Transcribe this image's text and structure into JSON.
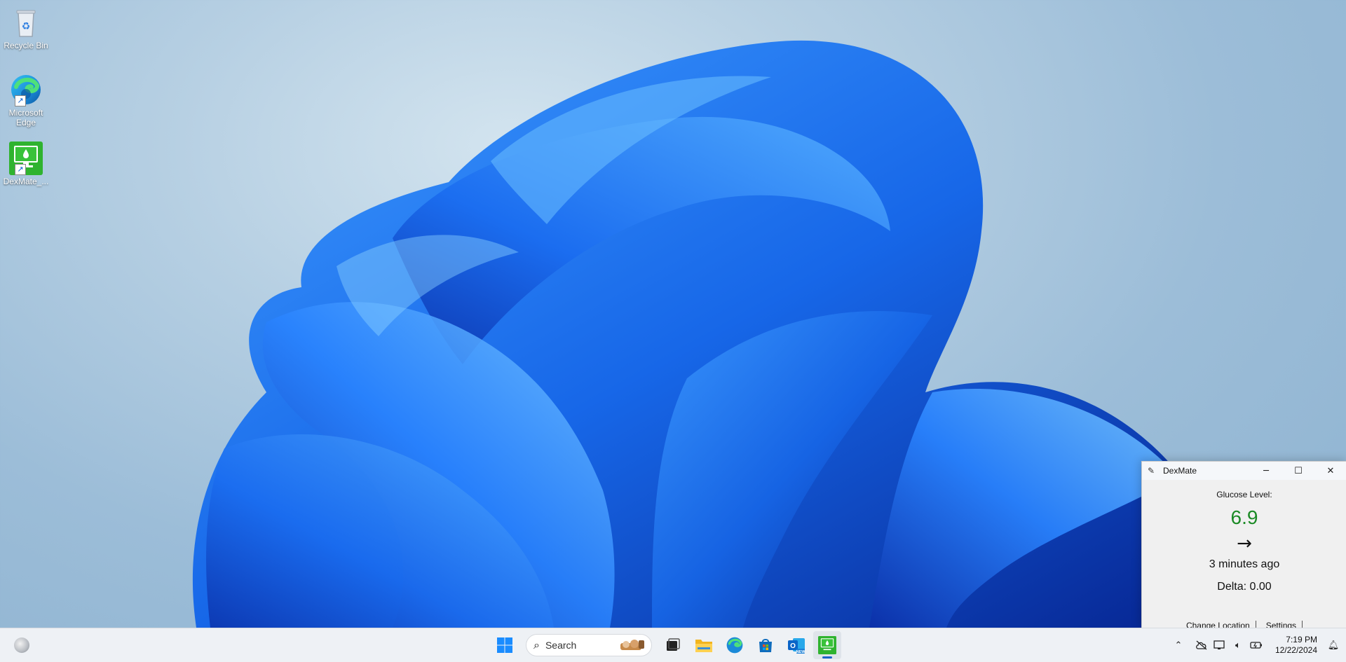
{
  "desktop": {
    "icons": [
      {
        "label": "Recycle Bin"
      },
      {
        "label": "Microsoft Edge"
      },
      {
        "label": "DexMate_..."
      }
    ]
  },
  "dexmate": {
    "title": "DexMate",
    "glucose_label": "Glucose Level:",
    "glucose_value": "6.9",
    "trend_arrow": "→",
    "last_update": "3 minutes ago",
    "delta": "Delta: 0.00",
    "links": [
      "Change Location",
      "Settings"
    ],
    "value_color": "#1b8a25"
  },
  "taskbar": {
    "search_placeholder": "Search",
    "apps": [
      "windows-start",
      "search",
      "task-view",
      "file-explorer",
      "microsoft-edge",
      "microsoft-store",
      "outlook-new",
      "dexmate"
    ],
    "active_app": "dexmate",
    "clock": {
      "time": "7:19 PM",
      "date": "12/22/2024"
    }
  }
}
